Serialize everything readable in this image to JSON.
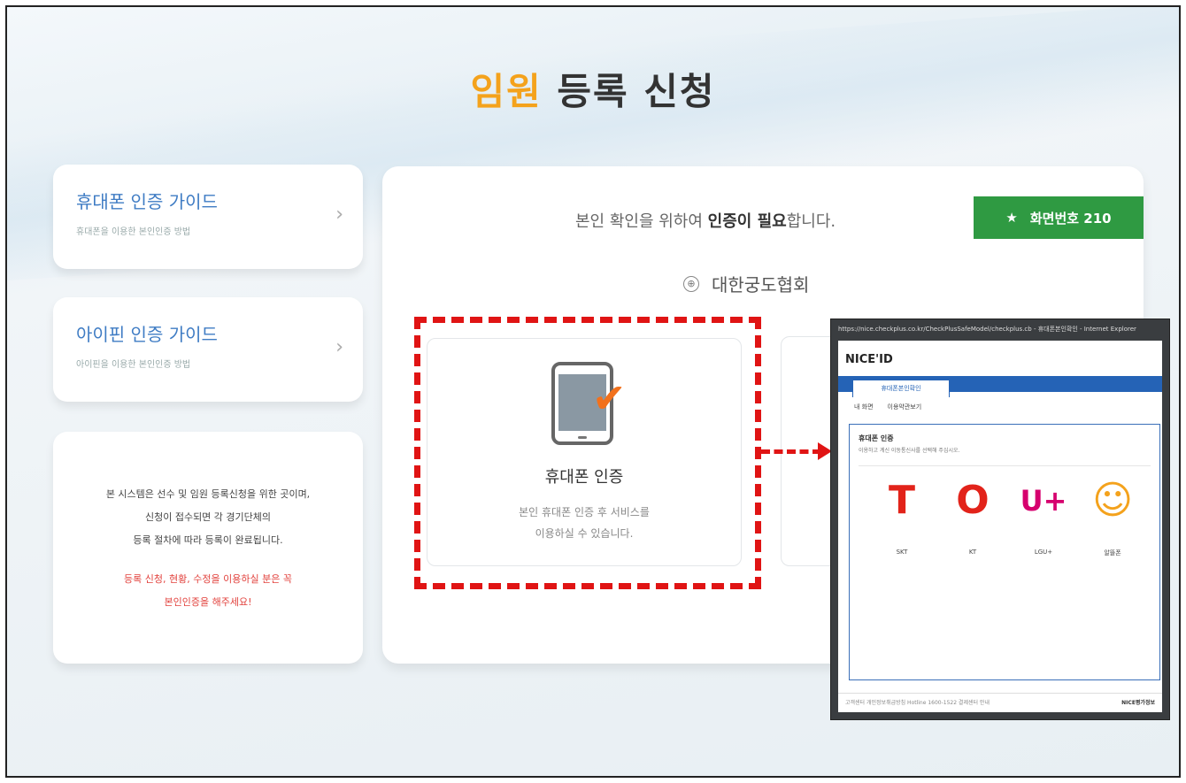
{
  "title": {
    "accent": "임원",
    "rest": " 등록 신청"
  },
  "guides": [
    {
      "title": "휴대폰 인증 가이드",
      "subtitle": "휴대폰을 이용한 본인인증 방법",
      "chevron": "›"
    },
    {
      "title": "아이핀 인증 가이드",
      "subtitle": "아이핀을 이용한 본인인증 방법",
      "chevron": "›"
    }
  ],
  "notice": {
    "lines": [
      "본 시스템은 선수 및 임원 등록신청을 위한 곳이며,",
      "신청이 접수되면 각 경기단체의",
      "등록 절차에 따라 등록이 완료됩니다."
    ],
    "warn_lines": [
      "등록 신청, 현황, 수정을 이용하실 분은 꼭",
      "본인인증을 해주세요!"
    ]
  },
  "main": {
    "need_auth_pre": "본인 확인을 위하여 ",
    "need_auth_bold": "인증이 필요",
    "need_auth_post": "합니다.",
    "screen_badge": {
      "star": "★",
      "label": "화면번호 210"
    },
    "association": {
      "icon": "⊕",
      "name": "대한궁도협회"
    },
    "phone_card": {
      "title": "휴대폰 인증",
      "desc1": "본인 휴대폰 인증 후 서비스를",
      "desc2": "이용하실 수 있습니다."
    }
  },
  "popup": {
    "titlebar": "https://nice.checkplus.co.kr/CheckPlusSafeModel/checkplus.cb - 휴대폰본인확인 - Internet Explorer",
    "logo": "NICE'ID",
    "tab": "휴대폰본인확인",
    "subtabs": [
      "내 화면",
      "이용약관보기"
    ],
    "inner_title": "휴대폰 인증",
    "inner_desc": "이용하고 계신 이동통신사를 선택해 주십시오.",
    "carriers": [
      {
        "glyph": "T",
        "name": "SKT",
        "color": "#e2231a"
      },
      {
        "glyph": "O",
        "name": "KT",
        "color": "#e2231a"
      },
      {
        "glyph": "U+",
        "name": "LGU+",
        "color": "#d6006e"
      },
      {
        "glyph": "☺",
        "name": "알뜰폰",
        "color": "#f4a21c"
      }
    ],
    "footer_left": "고객센터 개인정보취급방침 Hotline 1600-1522 결제센터 안내",
    "footer_right": "NICE평가정보"
  }
}
